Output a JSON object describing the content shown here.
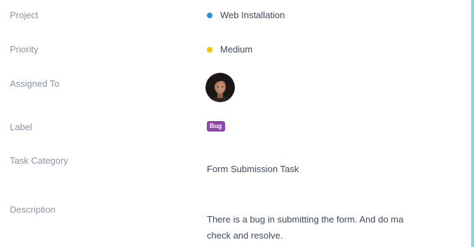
{
  "details": {
    "project": {
      "label": "Project",
      "value": "Web Installation",
      "dot_color": "#2d8fd5"
    },
    "priority": {
      "label": "Priority",
      "value": "Medium",
      "dot_color": "#f5c211"
    },
    "assigned_to": {
      "label": "Assigned To",
      "avatar_icon": "user-avatar"
    },
    "label_field": {
      "label": "Label",
      "badge": "Bug",
      "badge_color": "#8e44ad"
    },
    "task_category": {
      "label": "Task Category",
      "value": "Form Submission Task"
    },
    "description": {
      "label": "Description",
      "line1": "There is a bug in submitting the form. And do ma",
      "line2": "check and resolve."
    }
  },
  "accent_color": "#7fd6e4"
}
